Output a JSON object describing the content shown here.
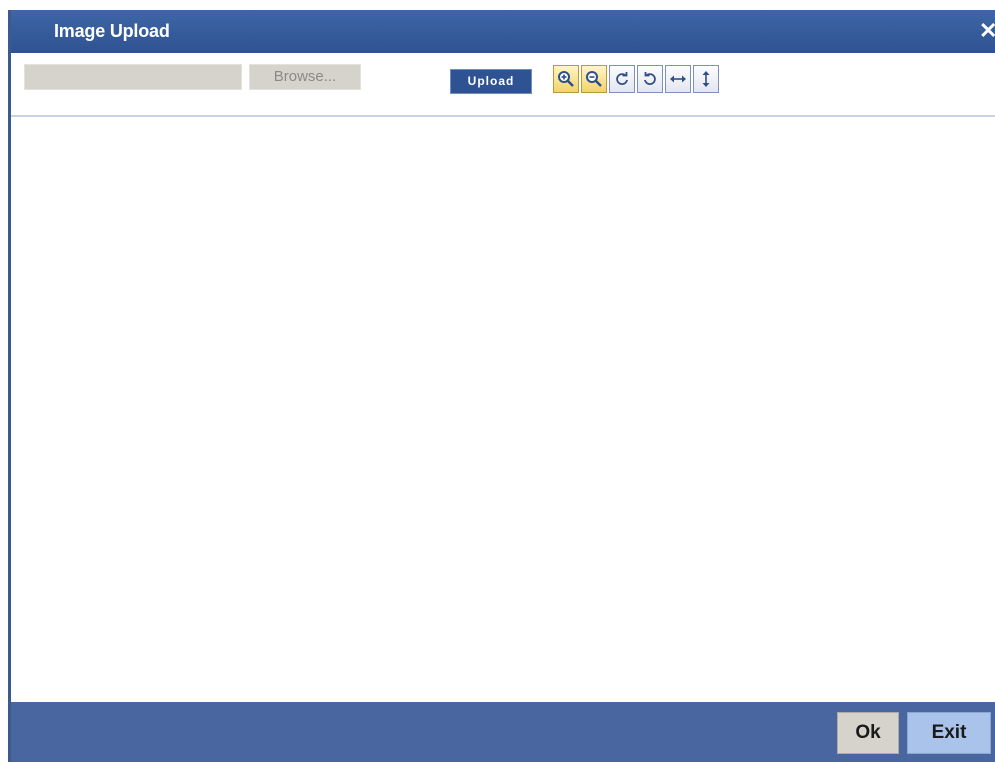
{
  "dialog": {
    "title": "Image Upload",
    "close_glyph": "✕"
  },
  "toolbar": {
    "file_value": "",
    "browse_label": "Browse...",
    "upload_label": "Upload",
    "tools": [
      {
        "icon": "zoom-in-icon"
      },
      {
        "icon": "zoom-out-icon"
      },
      {
        "icon": "rotate-right-icon"
      },
      {
        "icon": "rotate-left-icon"
      },
      {
        "icon": "flip-horizontal-icon"
      },
      {
        "icon": "flip-vertical-icon"
      }
    ]
  },
  "footer": {
    "ok_label": "Ok",
    "exit_label": "Exit"
  },
  "colors": {
    "titlebar": "#2f5292",
    "footer": "#4a66a0",
    "exit_button": "#a9c3ea",
    "button_gray": "#d6d3cc"
  }
}
